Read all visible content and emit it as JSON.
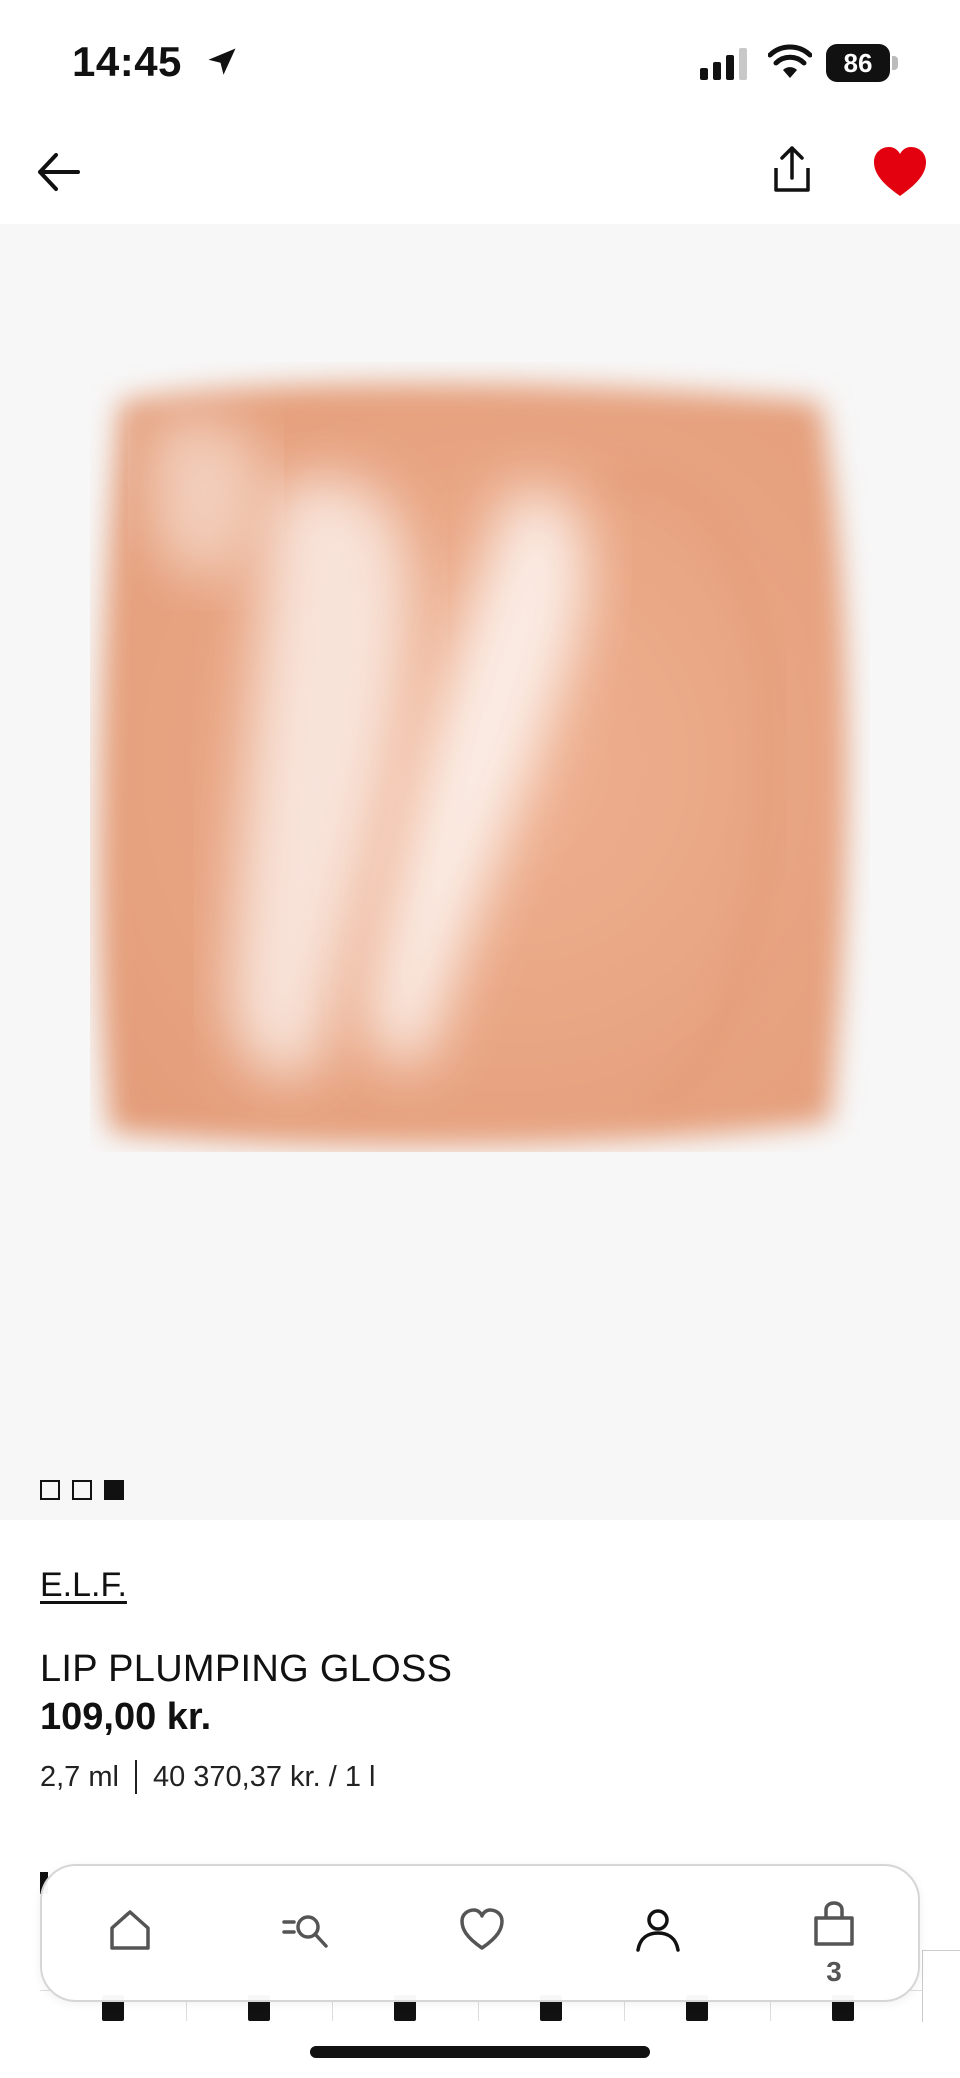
{
  "status_bar": {
    "time": "14:45",
    "battery": "86"
  },
  "nav": {
    "back_icon": "arrow-left-icon",
    "share_icon": "share-icon",
    "favorite_icon": "heart-filled-icon",
    "favorite_color": "#e3000f"
  },
  "gallery": {
    "image_count": 3,
    "active_index": 3,
    "swatch_color": "#e9a37f"
  },
  "product": {
    "brand": "E.L.F.",
    "name": "LIP PLUMPING GLOSS",
    "price": "109,00 kr.",
    "size": "2,7 ml",
    "unit_price": "40 370,37 kr. / 1 l"
  },
  "tab_bar": {
    "items": [
      {
        "icon": "home-icon"
      },
      {
        "icon": "search-categories-icon"
      },
      {
        "icon": "heart-outline-icon"
      },
      {
        "icon": "user-icon"
      },
      {
        "icon": "shopping-bag-icon",
        "badge": "3"
      }
    ]
  }
}
